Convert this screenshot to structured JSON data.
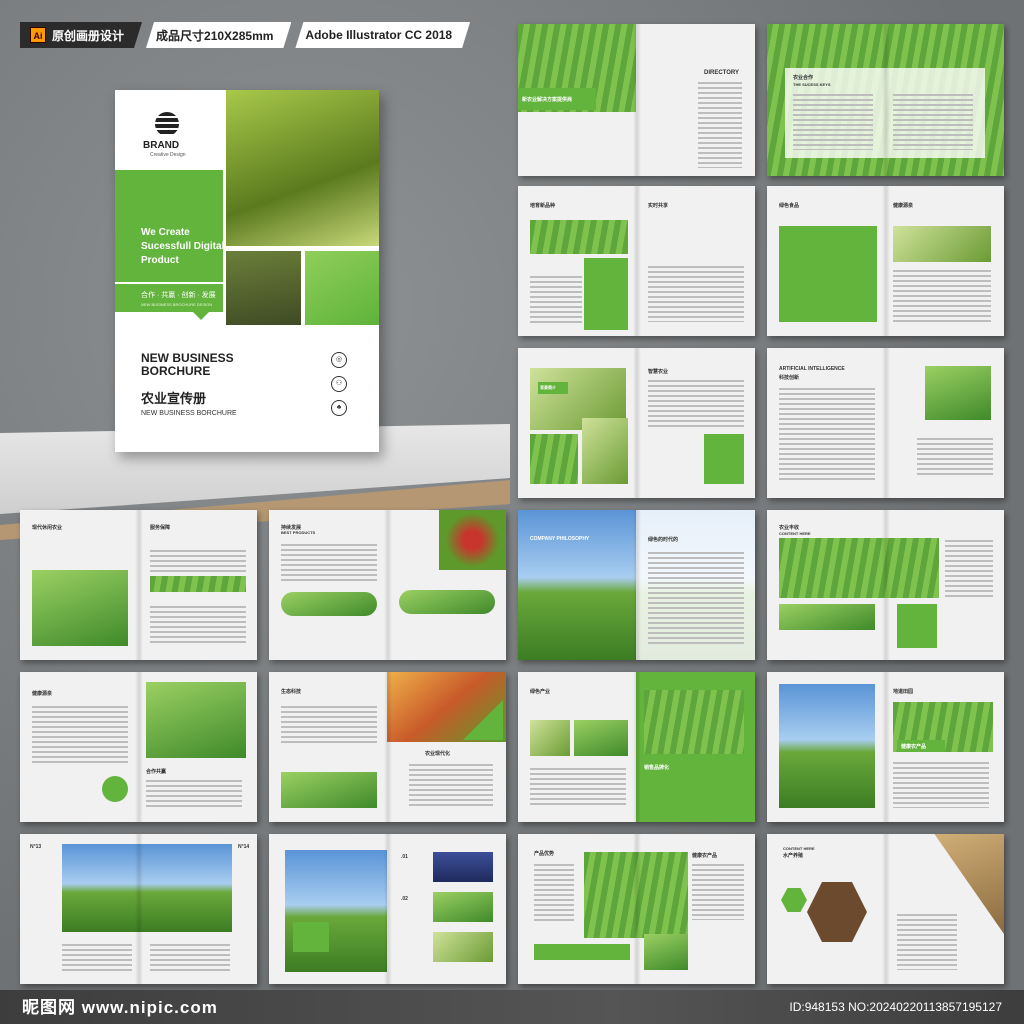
{
  "tags": [
    {
      "icon": "Ai",
      "label": "原创画册设计"
    },
    {
      "label": "成品尺寸210X285mm"
    },
    {
      "label": "Adobe Illustrator CC 2018"
    }
  ],
  "cover": {
    "brand": "BRAND",
    "brand_sub": "Creative Design",
    "slogan": "We Create Sucessfull Digital Product",
    "slogan_cn": "合作 · 共赢 · 创新 · 发展",
    "slogan_sub": "NEW BUSINESS BROCHURE DESIGN",
    "title": "NEW BUSINESS BORCHURE",
    "title_cn": "农业宣传册",
    "title_sub": "NEW BUSINESS BORCHURE"
  },
  "spreads": [
    {
      "t1": "新农业解决方案提供商",
      "t2": "DIRECTORY"
    },
    {
      "t1": "农业合作",
      "t2": "THE SUCESS KEYS"
    },
    {
      "t1": "培育新品种",
      "t2": "实时共享"
    },
    {
      "t1": "绿色食品",
      "t2": "健康源泉"
    },
    {
      "t1": "背景简介",
      "t2": "智慧农业"
    },
    {
      "t1": "ARTIFICIAL INTELLIGENCE",
      "t2": "科技创新"
    },
    {
      "t1": "现代休闲农业",
      "t2": "服务保障"
    },
    {
      "t1": "持续发展",
      "t2": "BEST PRODUCTS"
    },
    {
      "t1": "COMPANY PHILOSOPHY",
      "t2": "绿色的时代的"
    },
    {
      "t1": "农业丰收",
      "t2": "CONTENT HERE"
    },
    {
      "t1": "健康源泉",
      "t2": "合作共赢"
    },
    {
      "t1": "生态科技",
      "t2": "农业现代化"
    },
    {
      "t1": "绿色产业",
      "t2": "销售品牌化"
    },
    {
      "t1": "地道田园",
      "t2": "健康农产品"
    },
    {
      "t1": "N°13",
      "t2": "N°14"
    },
    {
      "t1": ".01",
      "t2": ".02"
    },
    {
      "t1": "产品优势",
      "t2": "健康农产品"
    },
    {
      "t1": "水产养殖",
      "t2": "CONTENT HERE"
    }
  ],
  "watermark": {
    "site": "昵图网 www.nipic.com",
    "id": "ID:948153 NO:20240220113857195127"
  },
  "colors": {
    "accent": "#63b43d",
    "background": "#7b7e80"
  }
}
